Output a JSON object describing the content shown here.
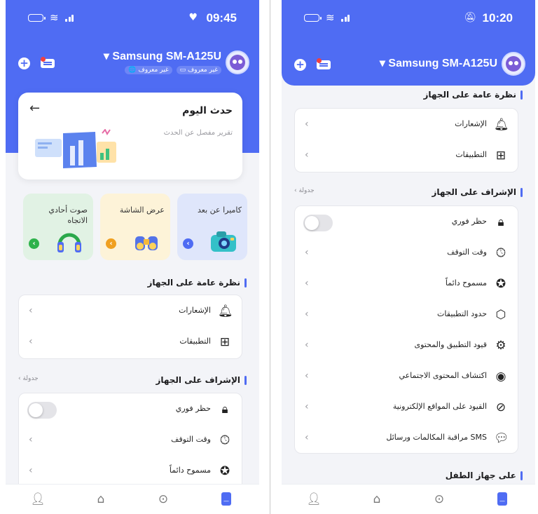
{
  "colors": {
    "brand": "#4f6cf3",
    "card_blue": "#dfe6fb",
    "card_yellow": "#fdf3d8",
    "card_green": "#e1f2e4"
  },
  "screen1": {
    "status": {
      "time": "09:45",
      "right_icon": "heart-icon"
    },
    "header": {
      "device_name": "Samsung SM-A125U",
      "tag_unknown_1": "غير معروف",
      "tag_unknown_2": "غير معروف"
    },
    "event": {
      "title": "حدث اليوم",
      "subtitle": "تقرير مفصل عن الحدث"
    },
    "features": [
      {
        "label": "كاميرا عن بعد",
        "icon": "camera-icon"
      },
      {
        "label": "عرض الشاشة",
        "icon": "binoculars-icon"
      },
      {
        "label": "صوت أحادي الاتجاه",
        "icon": "headphones-icon"
      }
    ],
    "overview": {
      "title": "نظرة عامة على الجهاز",
      "items": [
        {
          "label": "الإشعارات",
          "icon": "bell-icon"
        },
        {
          "label": "التطبيقات",
          "icon": "apps-grid-icon"
        }
      ]
    },
    "supervision": {
      "title": "الإشراف على الجهاز",
      "link": "جدولة",
      "items": [
        {
          "label": "حظر فوري",
          "icon": "lock-icon"
        },
        {
          "label": "وقت التوقف",
          "icon": "clock-icon"
        },
        {
          "label": "مسموح دائماً",
          "icon": "badge-check-icon"
        }
      ]
    }
  },
  "screen2": {
    "status": {
      "time": "10:20",
      "right_icon": "bell-muted-icon"
    },
    "header": {
      "device_name": "Samsung SM-A125U"
    },
    "overview": {
      "title": "نظرة عامة على الجهاز",
      "items": [
        {
          "label": "الإشعارات",
          "icon": "bell-icon"
        },
        {
          "label": "التطبيقات",
          "icon": "apps-grid-icon"
        }
      ]
    },
    "supervision": {
      "title": "الإشراف على الجهاز",
      "link": "جدولة",
      "items": [
        {
          "label": "حظر فوري",
          "icon": "lock-icon"
        },
        {
          "label": "وقت التوقف",
          "icon": "clock-icon"
        },
        {
          "label": "مسموح دائماً",
          "icon": "badge-check-icon"
        },
        {
          "label": "حدود التطبيقات",
          "icon": "app-limit-icon"
        },
        {
          "label": "قيود التطبيق والمحتوى",
          "icon": "settings-doc-icon"
        },
        {
          "label": "اكتشاف المحتوى الاجتماعي",
          "icon": "eye-icon"
        },
        {
          "label": "القيود على المواقع الإلكترونية",
          "icon": "planet-icon"
        },
        {
          "label": "مراقبة المكالمات ورسائل SMS",
          "icon": "chat-icon"
        }
      ]
    },
    "child_device": {
      "title": "على جهاز الطفل"
    }
  },
  "tabbar": [
    {
      "name": "profile",
      "icon": "person-icon"
    },
    {
      "name": "home",
      "icon": "house-icon"
    },
    {
      "name": "location",
      "icon": "location-pin-icon"
    },
    {
      "name": "device",
      "icon": "phone-icon"
    }
  ]
}
